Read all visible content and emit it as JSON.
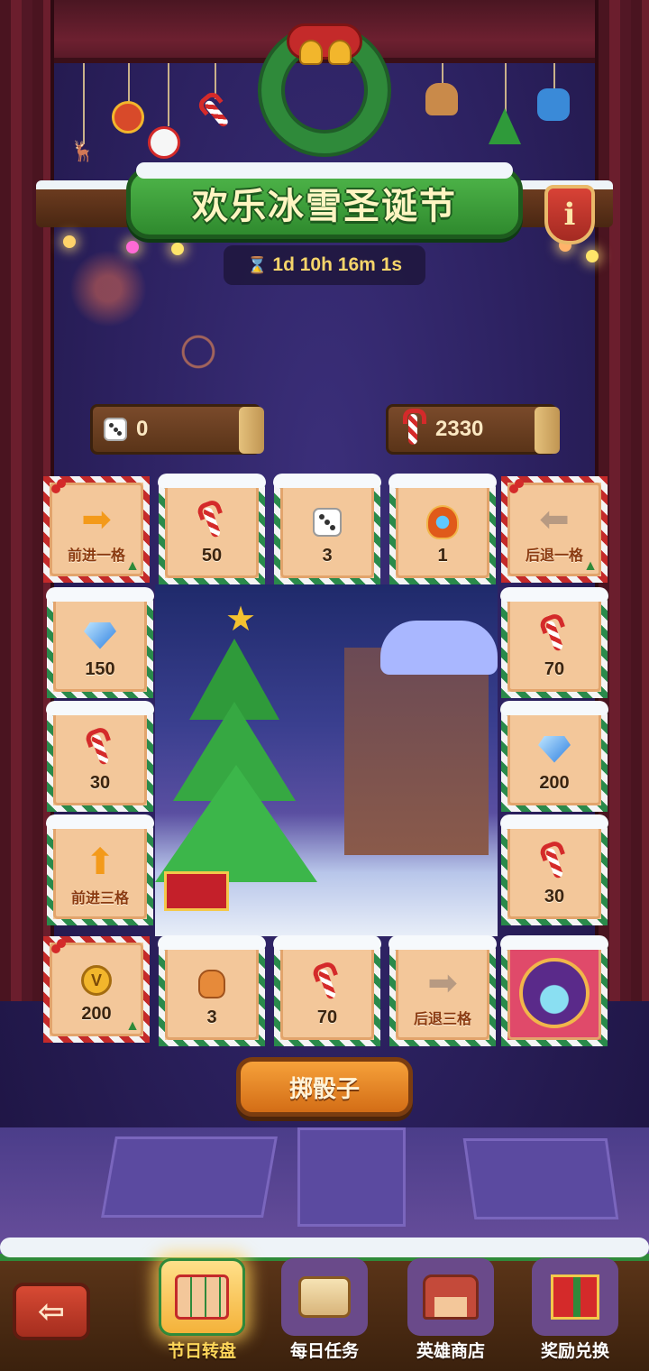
{
  "header": {
    "title": "欢乐冰雪圣诞节",
    "timer": "1d 10h 16m 1s",
    "info_label": "i"
  },
  "counters": {
    "dice": {
      "icon": "dice-icon",
      "value": "0"
    },
    "candy": {
      "icon": "candy-cane-icon",
      "value": "2330"
    }
  },
  "board": {
    "top_row": [
      {
        "type": "move",
        "label": "前进一格",
        "icon": "arrow-right-icon"
      },
      {
        "type": "reward",
        "label": "50",
        "icon": "candy-cane-icon"
      },
      {
        "type": "reward",
        "label": "3",
        "icon": "dice-icon"
      },
      {
        "type": "reward",
        "label": "1",
        "icon": "fire-crest-icon"
      },
      {
        "type": "move",
        "label": "后退一格",
        "icon": "arrow-left-icon"
      }
    ],
    "left_column": [
      {
        "type": "reward",
        "label": "150",
        "icon": "diamond-icon"
      },
      {
        "type": "reward",
        "label": "30",
        "icon": "candy-cane-icon"
      },
      {
        "type": "move",
        "label": "前进三格",
        "icon": "arrow-up-icon"
      }
    ],
    "right_column": [
      {
        "type": "reward",
        "label": "70",
        "icon": "candy-cane-icon"
      },
      {
        "type": "reward",
        "label": "200",
        "icon": "diamond-icon"
      },
      {
        "type": "reward",
        "label": "30",
        "icon": "candy-cane-icon"
      }
    ],
    "bottom_row": [
      {
        "type": "reward",
        "label": "200",
        "icon": "vip-coin-icon"
      },
      {
        "type": "reward",
        "label": "3",
        "icon": "gift-bag-icon"
      },
      {
        "type": "reward",
        "label": "70",
        "icon": "candy-cane-icon"
      },
      {
        "type": "move",
        "label": "后退三格",
        "icon": "arrow-right-icon"
      },
      {
        "type": "hero",
        "label": "",
        "icon": "hero-avatar-icon"
      }
    ]
  },
  "roll_button": {
    "label": "掷骰子"
  },
  "bottom_nav": {
    "items": [
      {
        "label": "节日转盘",
        "icon": "festival-board-icon",
        "active": true
      },
      {
        "label": "每日任务",
        "icon": "scroll-quest-icon",
        "active": false
      },
      {
        "label": "英雄商店",
        "icon": "shop-icon",
        "active": false
      },
      {
        "label": "奖励兑换",
        "icon": "gift-box-icon",
        "active": false
      }
    ]
  },
  "colors": {
    "accent_green": "#2f8a3a",
    "tile_bg": "#f3c79a",
    "candy_red": "#d42a2a",
    "timer_gold": "#f6d56a",
    "active_nav": "#ffd75a"
  }
}
